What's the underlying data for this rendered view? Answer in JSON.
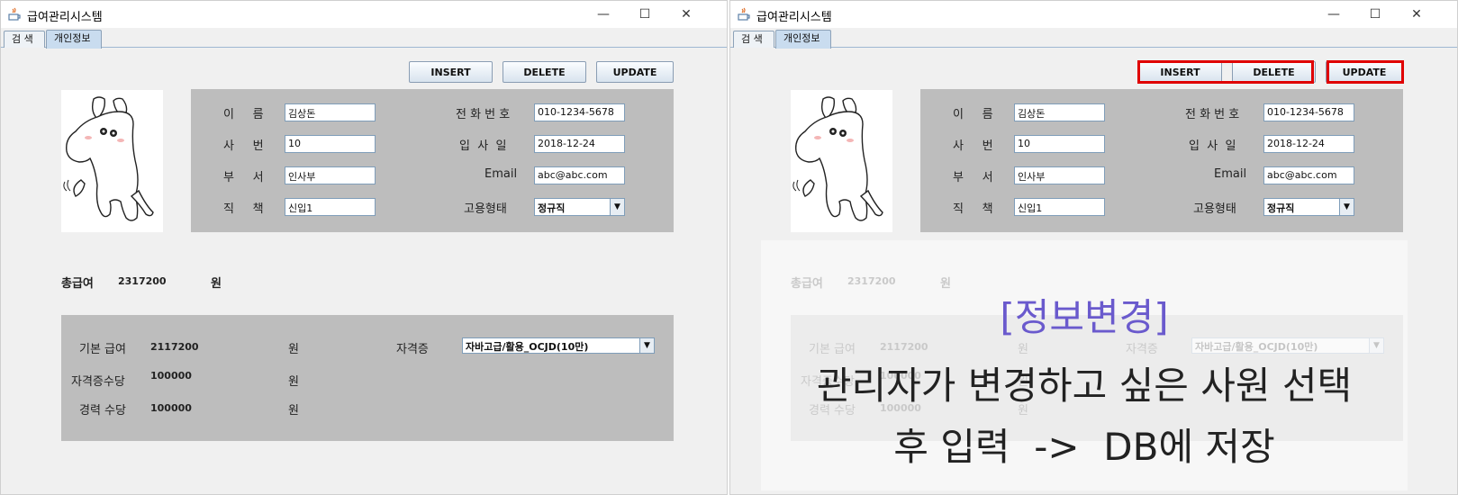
{
  "window": {
    "title": "급여관리시스템",
    "controls": [
      "—",
      "☐",
      "✕"
    ]
  },
  "tabs": [
    {
      "label": "검  색",
      "active": false
    },
    {
      "label": "개인정보",
      "active": true
    }
  ],
  "buttons": {
    "insert": "INSERT",
    "delete": "DELETE",
    "update": "UPDATE"
  },
  "info": {
    "name_label": "이     름",
    "name_value": "김상돈",
    "empno_label": "사     번",
    "empno_value": "10",
    "dept_label": "부     서",
    "dept_value": "인사부",
    "position_label": "직     책",
    "position_value": "신입1",
    "phone_label": "전 화 번 호",
    "phone_value": "010-1234-5678",
    "hire_label": "입  사  일",
    "hire_value": "2018-12-24",
    "email_label": "Email",
    "email_value": "abc@abc.com",
    "emptype_label": "고용형태",
    "emptype_value": "정규직"
  },
  "total": {
    "label": "총급여",
    "value": "2317200",
    "unit": "원"
  },
  "salary": {
    "base_label": "기본 급여",
    "base_value": "2117200",
    "base_unit": "원",
    "cert_allow_label": "자격증수당",
    "cert_allow_value": "100000",
    "cert_allow_unit": "원",
    "career_allow_label": "경력 수당",
    "career_allow_value": "100000",
    "career_allow_unit": "원",
    "cert_label": "자격증",
    "cert_value": "자바고급/활용_OCJD(10만)"
  },
  "overlay": {
    "title": "[정보변경]",
    "line1": "관리자가 변경하고 싶은 사원 선택",
    "line2": "후 입력  ->  DB에 저장"
  },
  "colors": {
    "highlight": "#e00000",
    "overlay_title": "#6a5acd",
    "panel_gray": "#bdbdbd"
  }
}
